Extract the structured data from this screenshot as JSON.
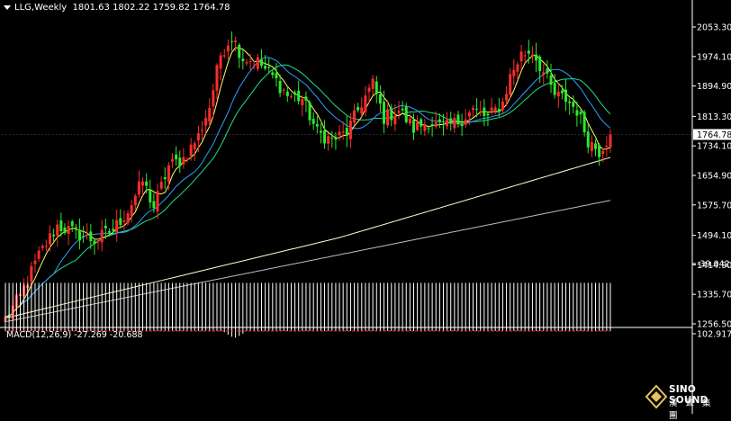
{
  "header": {
    "symbol": "LLG,Weekly",
    "ohlc": "1801.63 1802.22 1759.82 1764.78"
  },
  "macd_header": "MACD(12,26,9) -27.269 -20.688",
  "logo": {
    "name": "SINO SOUND",
    "tagline": "漢 聲 集 團"
  },
  "colors": {
    "bull": "#ff2b2b",
    "bear": "#2ee82e",
    "ma5": "#ffff66",
    "ma10": "#2e9fff",
    "ma20": "#22dd88",
    "ma60": "#ffffcc",
    "ma120": "#bbbbbb",
    "macd_hist": "#ffffff",
    "macd_signal": "#ff2020",
    "grid": "#141414",
    "axis": "#ffffff"
  },
  "chart_data": [
    {
      "type": "candlestick",
      "symbol": "LLG",
      "timeframe": "Weekly",
      "last_price": 1764.78,
      "y_ticks": [
        2053.3,
        1974.1,
        1894.9,
        1813.3,
        1734.1,
        1654.9,
        1575.7,
        1494.1,
        1414.9,
        1335.7,
        1256.5
      ],
      "ylim": [
        1256.5,
        2085
      ],
      "moving_averages": [
        "ma5",
        "ma10",
        "ma20",
        "ma60",
        "ma120"
      ],
      "approx_path": [
        [
          0,
          1270
        ],
        [
          4,
          1330
        ],
        [
          9,
          1440
        ],
        [
          14,
          1520
        ],
        [
          19,
          1500
        ],
        [
          24,
          1480
        ],
        [
          29,
          1510
        ],
        [
          33,
          1560
        ],
        [
          37,
          1640
        ],
        [
          40,
          1570
        ],
        [
          44,
          1680
        ],
        [
          48,
          1700
        ],
        [
          52,
          1760
        ],
        [
          55,
          1840
        ],
        [
          58,
          1980
        ],
        [
          61,
          2030
        ],
        [
          64,
          1970
        ],
        [
          68,
          1960
        ],
        [
          72,
          1920
        ],
        [
          76,
          1870
        ],
        [
          80,
          1860
        ],
        [
          84,
          1770
        ],
        [
          88,
          1750
        ],
        [
          92,
          1770
        ],
        [
          96,
          1850
        ],
        [
          99,
          1900
        ],
        [
          102,
          1810
        ],
        [
          106,
          1830
        ],
        [
          110,
          1780
        ],
        [
          114,
          1800
        ],
        [
          118,
          1780
        ],
        [
          122,
          1800
        ],
        [
          126,
          1830
        ],
        [
          130,
          1810
        ],
        [
          134,
          1850
        ],
        [
          136,
          1920
        ],
        [
          139,
          1980
        ],
        [
          142,
          1990
        ],
        [
          145,
          1930
        ],
        [
          148,
          1870
        ],
        [
          151,
          1860
        ],
        [
          154,
          1830
        ],
        [
          157,
          1750
        ],
        [
          160,
          1720
        ],
        [
          163,
          1765
        ]
      ]
    },
    {
      "type": "bar",
      "name": "MACD(12,26,9)",
      "main": -27.269,
      "signal": -20.688,
      "y_ticks": [
        102.917,
        -39.042
      ],
      "ylim": [
        -39.042,
        102.917
      ]
    }
  ]
}
